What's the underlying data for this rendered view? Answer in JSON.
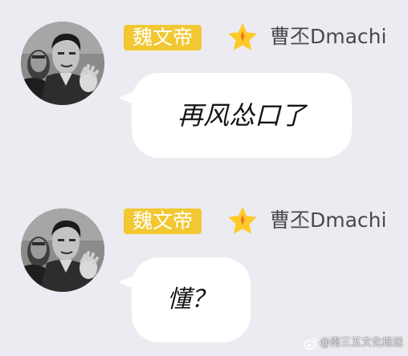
{
  "messages": [
    {
      "badge": "魏文帝",
      "star_icon": "star-icon",
      "username": "曹丕Dmachi",
      "text": "再风怂口了"
    },
    {
      "badge": "魏文帝",
      "star_icon": "star-icon",
      "username": "曹丕Dmachi",
      "text": "懂？"
    }
  ],
  "watermark": {
    "icon": "weibo-icon",
    "text": "@南三五文化推送"
  },
  "colors": {
    "background": "#ebebf1",
    "badge": "#f1c832",
    "star": "#ffc928",
    "bubble": "#ffffff",
    "username": "#4a4a4a"
  }
}
